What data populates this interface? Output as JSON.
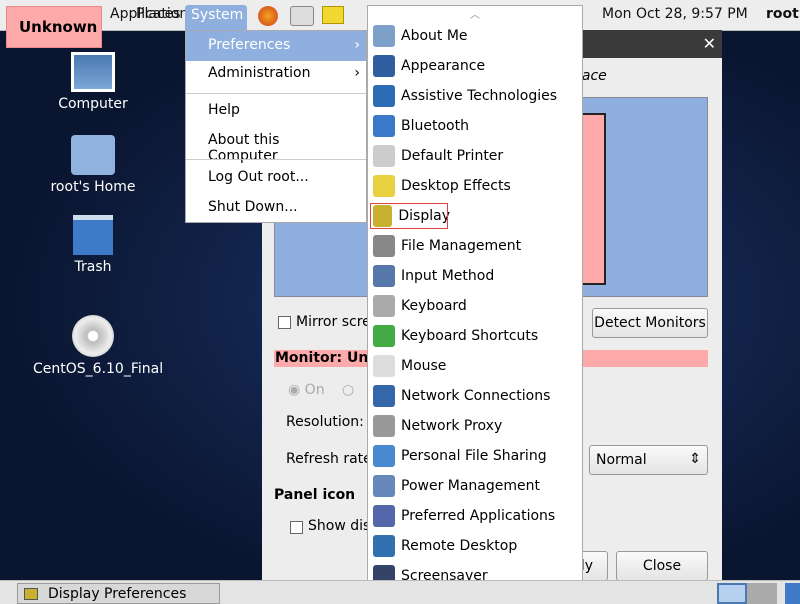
{
  "top_panel": {
    "applications": "Applications",
    "places": "Places",
    "system": "System",
    "clock": "Mon Oct 28,  9:57 PM",
    "user": "root",
    "icons": [
      "firefox-icon",
      "mail-clock-icon",
      "notes-icon"
    ]
  },
  "overlay_label": "Unknown",
  "desktop": [
    {
      "label": "Computer",
      "icon": "computer-icon"
    },
    {
      "label": "root's Home",
      "icon": "home-folder-icon"
    },
    {
      "label": "Trash",
      "icon": "trash-icon"
    },
    {
      "label": "CentOS_6.10_Final",
      "icon": "dvd-icon"
    }
  ],
  "system_menu": [
    "Preferences",
    "Administration",
    "Help",
    "About this Computer",
    "Log Out root...",
    "Shut Down..."
  ],
  "preferences_menu": [
    {
      "label": "About Me",
      "color": "#7da0c8"
    },
    {
      "label": "Appearance",
      "color": "#2f5f9f"
    },
    {
      "label": "Assistive Technologies",
      "color": "#2d6bb5"
    },
    {
      "label": "Bluetooth",
      "color": "#3a78c8"
    },
    {
      "label": "Default Printer",
      "color": "#cccccc"
    },
    {
      "label": "Desktop Effects",
      "color": "#e8d040"
    },
    {
      "label": "Display",
      "color": "#c8b030"
    },
    {
      "label": "File Management",
      "color": "#888888"
    },
    {
      "label": "Input Method",
      "color": "#5577aa"
    },
    {
      "label": "Keyboard",
      "color": "#aaaaaa"
    },
    {
      "label": "Keyboard Shortcuts",
      "color": "#44aa44"
    },
    {
      "label": "Mouse",
      "color": "#dddddd"
    },
    {
      "label": "Network Connections",
      "color": "#3366aa"
    },
    {
      "label": "Network Proxy",
      "color": "#999999"
    },
    {
      "label": "Personal File Sharing",
      "color": "#4a88d0"
    },
    {
      "label": "Power Management",
      "color": "#6688bb"
    },
    {
      "label": "Preferred Applications",
      "color": "#5566aa"
    },
    {
      "label": "Remote Desktop",
      "color": "#3370b0"
    },
    {
      "label": "Screensaver",
      "color": "#334466"
    }
  ],
  "selected_pref": "Display",
  "dialog": {
    "title_partial": "lace",
    "mirror": "Mirror scre",
    "detect": "Detect Monitors",
    "monitor": "Monitor: Unl",
    "on": "On",
    "resolution": "Resolution:",
    "refresh": "Refresh rate",
    "rotation_value": "Normal",
    "panel_icon": "Panel icon",
    "show": "Show dis",
    "apply_partial": "ly",
    "close": "Close"
  },
  "taskbar": {
    "window": "Display Preferences"
  }
}
